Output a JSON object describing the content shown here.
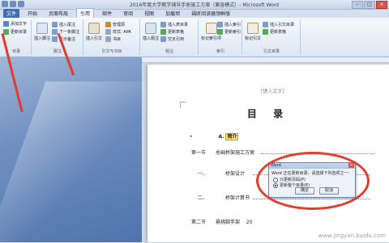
{
  "window": {
    "title": "2016年度大学教学辅导手册施工方案（兼容模式）- Microsoft Word",
    "controls": [
      "–",
      "□",
      "×"
    ]
  },
  "tabs": [
    "文件",
    "开始",
    "页面布局",
    "引用",
    "邮件",
    "审阅",
    "视图",
    "加载项",
    "福昕阅读器领鲜版"
  ],
  "ribbon": {
    "groups": [
      {
        "name": "目录",
        "buttons": [
          "添加文字",
          "更新目录"
        ]
      },
      {
        "name": "脚注",
        "buttons": [
          "插入脚注",
          "插入尾注",
          "下一条脚注",
          "显示备注"
        ]
      },
      {
        "name": "引文与书目",
        "buttons": [
          "插入引文",
          "管理源",
          "样式: APA",
          "书目"
        ]
      },
      {
        "name": "题注",
        "buttons": [
          "插入题注",
          "插入表目录",
          "更新表格",
          "交叉引用"
        ]
      },
      {
        "name": "索引",
        "buttons": [
          "标记索引项",
          "插入索引",
          "更新索引"
        ]
      },
      {
        "name": "引文目录",
        "buttons": [
          "标记引文",
          "插入引文目录",
          "更新表格"
        ]
      }
    ]
  },
  "document": {
    "header_placeholder": "[键入文字]",
    "toc_title": "目  录",
    "entries": [
      {
        "marker": "•",
        "num": "A.",
        "text": "简介"
      },
      {
        "num": "第一节",
        "text": "总础桥架施工方案"
      },
      {
        "num": "一、",
        "text": "桥架设计"
      },
      {
        "num": "二、",
        "text": "桥架计算书"
      },
      {
        "num": "第二节",
        "text": "悬挑脚手架",
        "page": "20"
      }
    ]
  },
  "dialog": {
    "title": "Word",
    "close": "×",
    "prompt": "Word 正在更新目录，请选择下列选项之一：",
    "options": [
      {
        "label": "只更新页码(P)",
        "selected": false
      },
      {
        "label": "更新整个目录(E)",
        "selected": true
      }
    ],
    "ok": "确定",
    "cancel": "取消"
  },
  "watermark": "www.jingyan.baidu.com",
  "colors": {
    "annotation_red": "#e23b2f",
    "file_tab": "#3f6fb5",
    "highlight": "#ffe27a"
  }
}
